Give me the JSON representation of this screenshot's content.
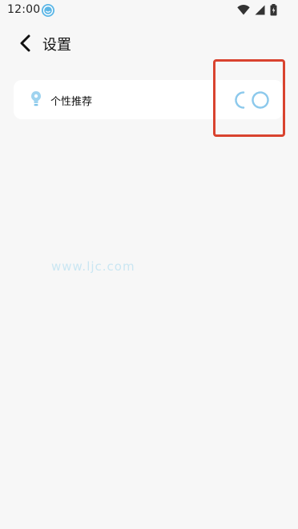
{
  "status_bar": {
    "time": "12:00",
    "app_icon": "smiley-app-icon",
    "icons": [
      "wifi-icon",
      "signal-icon",
      "battery-icon"
    ]
  },
  "header": {
    "back_icon": "chevron-left-icon",
    "title": "设置"
  },
  "settings": {
    "rows": [
      {
        "icon": "sparkle-icon",
        "label": "个性推荐",
        "toggle_state": "loading"
      }
    ]
  },
  "watermark": {
    "text": "www.ljc.com"
  },
  "colors": {
    "background": "#f7f7f7",
    "card": "#ffffff",
    "highlight": "#d9432f",
    "accent": "#5bb6e6"
  }
}
